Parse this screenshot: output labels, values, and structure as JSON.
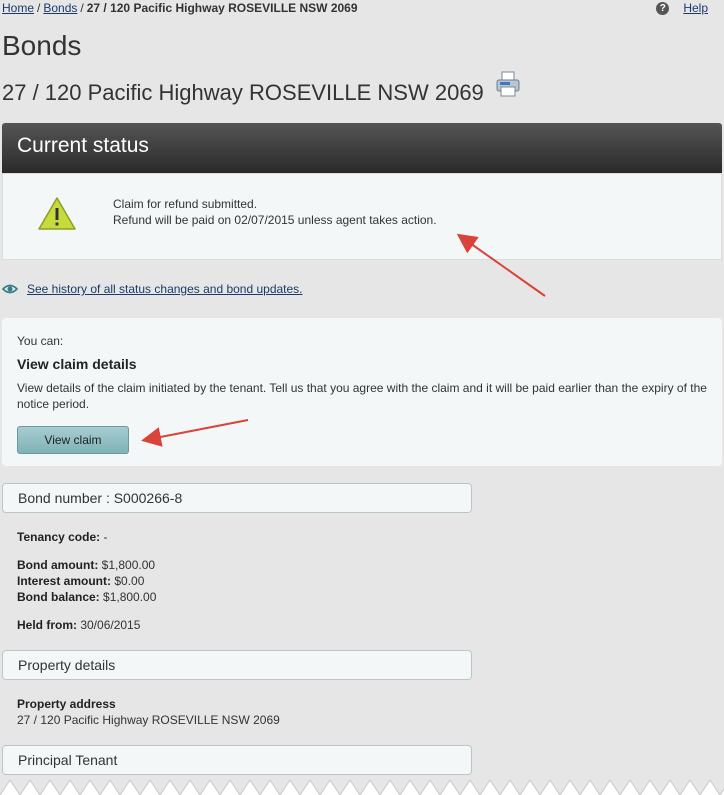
{
  "breadcrumb": {
    "home": "Home",
    "bonds": "Bonds",
    "separator": "/",
    "current": "27 / 120 Pacific Highway ROSEVILLE NSW 2069"
  },
  "help": {
    "icon": "help-circle-icon",
    "label": "Help"
  },
  "page": {
    "title": "Bonds",
    "address": "27 / 120 Pacific Highway ROSEVILLE NSW 2069"
  },
  "status": {
    "header": "Current status",
    "line1": "Claim for refund submitted.",
    "line2": "Refund will be paid on 02/07/2015 unless agent takes action."
  },
  "history_link": "See history of all status changes and bond updates.",
  "actions": {
    "you_can": "You can:",
    "title": "View claim details",
    "description": "View details of the claim initiated by the tenant. Tell us that you agree with the claim and it will be paid earlier than the expiry of the notice period.",
    "button": "View claim"
  },
  "bond": {
    "header": "Bond number : S000266-8",
    "tenancy_code_label": "Tenancy code:",
    "tenancy_code_value": " -",
    "bond_amount_label": "Bond amount:",
    "bond_amount_value": " $1,800.00",
    "interest_amount_label": "Interest amount:",
    "interest_amount_value": " $0.00",
    "bond_balance_label": "Bond balance:",
    "bond_balance_value": " $1,800.00",
    "held_from_label": "Held from:",
    "held_from_value": " 30/06/2015"
  },
  "property": {
    "header": "Property details",
    "address_label": "Property address",
    "address_value": "27 / 120 Pacific Highway ROSEVILLE NSW 2069"
  },
  "tenant": {
    "header": "Principal Tenant"
  },
  "colors": {
    "header_dark": "#2a2a2a",
    "panel_bg": "#f4f7f8",
    "button_teal": "#80b3b7",
    "warning_green": "#c7dc3c",
    "annotation_red": "#d9433a",
    "link": "#1a3a6b"
  }
}
